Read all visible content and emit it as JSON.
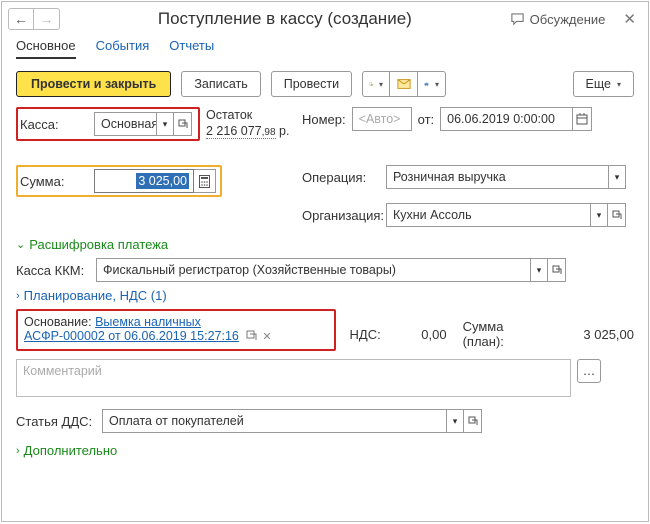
{
  "title": "Поступление в кассу (создание)",
  "discuss_label": "Обсуждение",
  "tabs": {
    "main": "Основное",
    "events": "События",
    "reports": "Отчеты"
  },
  "toolbar": {
    "post_close": "Провести и закрыть",
    "save": "Записать",
    "post": "Провести",
    "more": "Еще"
  },
  "kassa": {
    "label": "Касса:",
    "value": "Основная",
    "balance_label": "Остаток",
    "balance_whole": "2 216 077",
    "balance_frac": ",98",
    "balance_cur": "р."
  },
  "number": {
    "label": "Номер:",
    "placeholder": "<Авто>",
    "from_label": "от:",
    "date": "06.06.2019  0:00:00"
  },
  "sum": {
    "label": "Сумма:",
    "value": "3 025,00"
  },
  "operation": {
    "label": "Операция:",
    "value": "Розничная выручка"
  },
  "org": {
    "label": "Организация:",
    "value": "Кухни Ассоль"
  },
  "section_payment": "Расшифровка платежа",
  "kkm": {
    "label": "Касса ККМ:",
    "value": "Фискальный регистратор (Хозяйственные товары)"
  },
  "section_plan": "Планирование, НДС (1)",
  "basis": {
    "label": "Основание:",
    "link1": "Выемка наличных",
    "link2": "АСФР-000002 от 06.06.2019 15:27:16"
  },
  "nds": {
    "label": "НДС:",
    "value": "0,00",
    "plan_label": "Сумма (план):",
    "plan_value": "3 025,00"
  },
  "comment": {
    "placeholder": "Комментарий"
  },
  "dds": {
    "label": "Статья ДДС:",
    "value": "Оплата от покупателей"
  },
  "section_more": "Дополнительно"
}
